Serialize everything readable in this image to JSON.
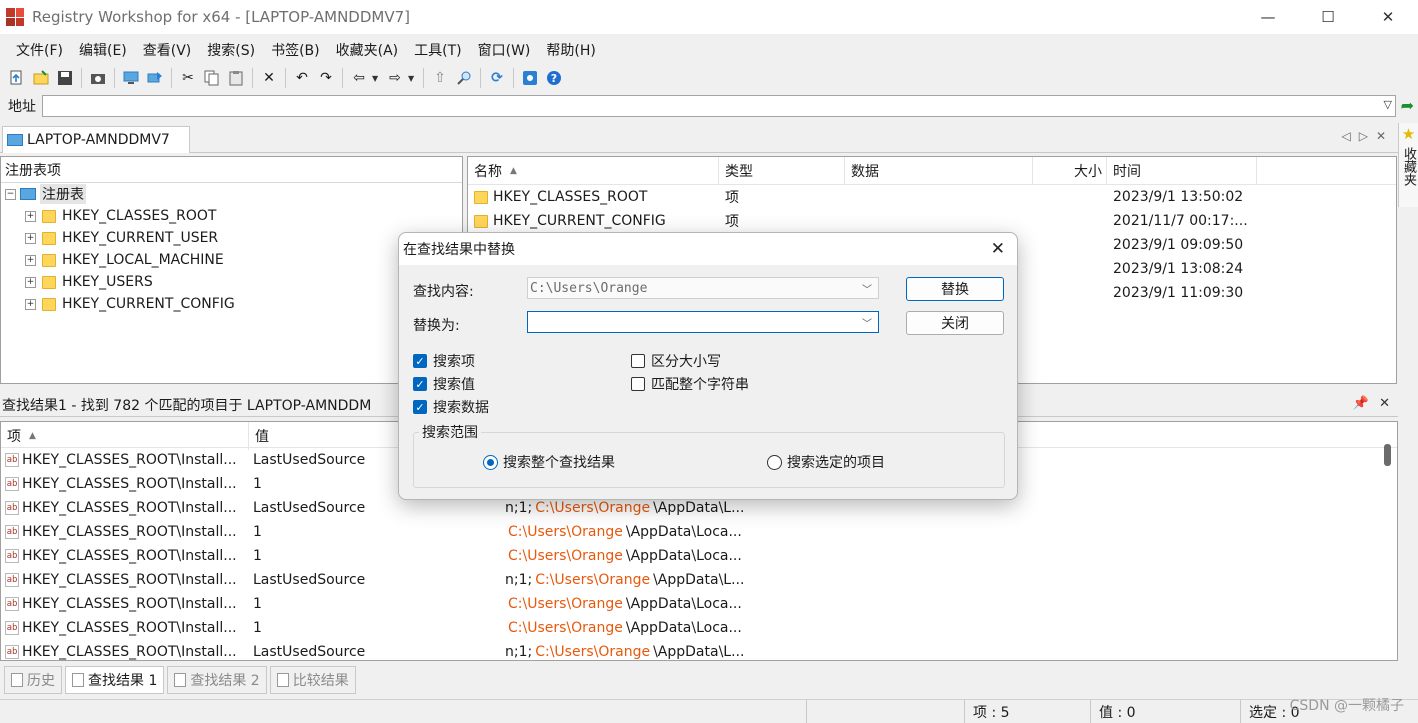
{
  "window": {
    "title": "Registry Workshop for x64 - [LAPTOP-AMNDDMV7]",
    "min_glyph": "—",
    "max_glyph": "☐",
    "close_glyph": "✕"
  },
  "menu": [
    "文件(F)",
    "编辑(E)",
    "查看(V)",
    "搜索(S)",
    "书签(B)",
    "收藏夹(A)",
    "工具(T)",
    "窗口(W)",
    "帮助(H)"
  ],
  "address": {
    "label": "地址",
    "value": ""
  },
  "doc_tab": {
    "label": "LAPTOP-AMNDDMV7"
  },
  "favorites": {
    "label": "收藏夹"
  },
  "tree": {
    "header": "注册表项",
    "root": "注册表",
    "items": [
      "HKEY_CLASSES_ROOT",
      "HKEY_CURRENT_USER",
      "HKEY_LOCAL_MACHINE",
      "HKEY_USERS",
      "HKEY_CURRENT_CONFIG"
    ]
  },
  "list": {
    "columns": {
      "name": "名称",
      "type": "类型",
      "data": "数据",
      "size": "大小",
      "time": "时间"
    },
    "rows": [
      {
        "name": "HKEY_CLASSES_ROOT",
        "type": "项",
        "time": "2023/9/1 13:50:02"
      },
      {
        "name": "HKEY_CURRENT_CONFIG",
        "type": "项",
        "time": "2021/11/7 00:17:..."
      },
      {
        "name": "",
        "type": "",
        "time": "2023/9/1 09:09:50"
      },
      {
        "name": "",
        "type": "",
        "time": "2023/9/1 13:08:24"
      },
      {
        "name": "",
        "type": "",
        "time": "2023/9/1 11:09:30"
      }
    ]
  },
  "results": {
    "header": "查找结果1 - 找到 782 个匹配的项目于 LAPTOP-AMNDDM",
    "columns": {
      "item": "项",
      "value": "值"
    },
    "rows": [
      {
        "item": "HKEY_CLASSES_ROOT\\Install...",
        "value": "LastUsedSource",
        "pre": "",
        "hl": "",
        "post": ""
      },
      {
        "item": "HKEY_CLASSES_ROOT\\Install...",
        "value": "1",
        "pre": "",
        "hl": "",
        "post": ""
      },
      {
        "item": "HKEY_CLASSES_ROOT\\Install...",
        "value": "LastUsedSource",
        "pre": "n;1;",
        "hl": "C:\\Users\\Orange",
        "post": "\\AppData\\L..."
      },
      {
        "item": "HKEY_CLASSES_ROOT\\Install...",
        "value": "1",
        "pre": "",
        "hl": "C:\\Users\\Orange",
        "post": "\\AppData\\Loca..."
      },
      {
        "item": "HKEY_CLASSES_ROOT\\Install...",
        "value": "1",
        "pre": "",
        "hl": "C:\\Users\\Orange",
        "post": "\\AppData\\Loca..."
      },
      {
        "item": "HKEY_CLASSES_ROOT\\Install...",
        "value": "LastUsedSource",
        "pre": "n;1;",
        "hl": "C:\\Users\\Orange",
        "post": "\\AppData\\L..."
      },
      {
        "item": "HKEY_CLASSES_ROOT\\Install...",
        "value": "1",
        "pre": "",
        "hl": "C:\\Users\\Orange",
        "post": "\\AppData\\Loca..."
      },
      {
        "item": "HKEY_CLASSES_ROOT\\Install...",
        "value": "1",
        "pre": "",
        "hl": "C:\\Users\\Orange",
        "post": "\\AppData\\Loca..."
      },
      {
        "item": "HKEY_CLASSES_ROOT\\Install...",
        "value": "LastUsedSource",
        "pre": "n;1;",
        "hl": "C:\\Users\\Orange",
        "post": "\\AppData\\L..."
      }
    ]
  },
  "bottom_tabs": [
    "历史",
    "查找结果 1",
    "查找结果 2",
    "比较结果"
  ],
  "status": {
    "items": "项 : 5",
    "values": "值 : 0",
    "selected": "选定 : 0"
  },
  "watermark": "CSDN @一颗橘子",
  "dialog": {
    "title": "在查找结果中替换",
    "find_label": "查找内容:",
    "find_value": "C:\\Users\\Orange",
    "replace_label": "替换为:",
    "replace_value": "",
    "replace_button": "替换",
    "close_button": "关闭",
    "options": {
      "search_keys": {
        "label": "搜索项",
        "checked": true
      },
      "search_values": {
        "label": "搜索值",
        "checked": true
      },
      "search_data": {
        "label": "搜索数据",
        "checked": true
      },
      "match_case": {
        "label": "区分大小写",
        "checked": false
      },
      "whole_string": {
        "label": "匹配整个字符串",
        "checked": false
      }
    },
    "scope_title": "搜索范围",
    "scope_all": "搜索整个查找结果",
    "scope_selected": "搜索选定的项目"
  },
  "colors": {
    "accent": "#0067c0",
    "highlight": "#e8590c",
    "folder": "#ffd65c"
  }
}
